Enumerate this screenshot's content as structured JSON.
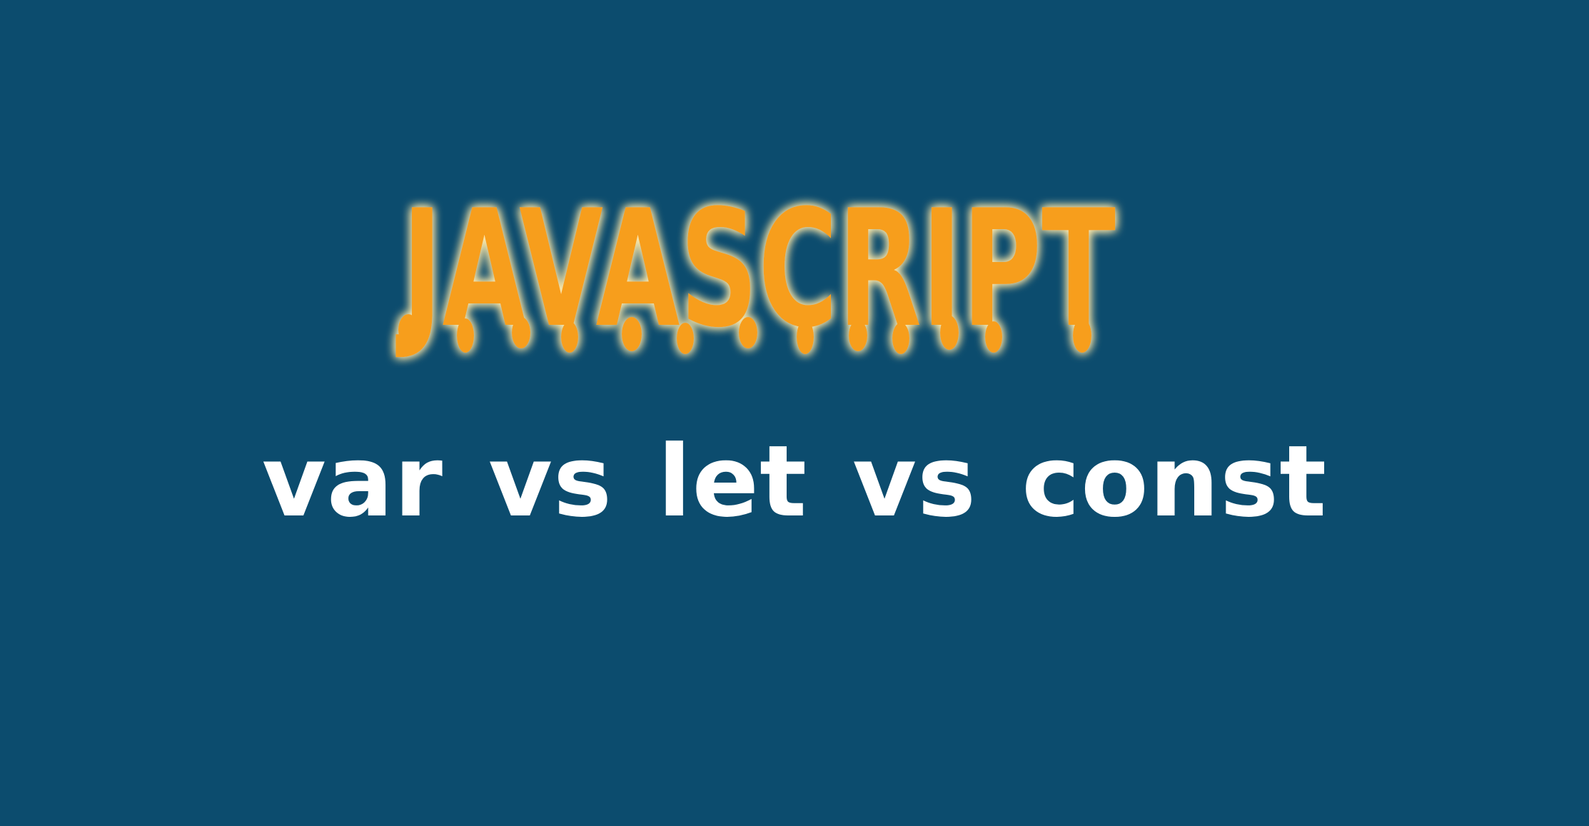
{
  "banner": {
    "background_color": "#0c4c6e",
    "title": "JAVASCRIPT",
    "title_color": "#f79e1b",
    "title_glow_color": "#ffe9a8",
    "subtitle": "var vs let vs const",
    "subtitle_color": "#ffffff"
  }
}
